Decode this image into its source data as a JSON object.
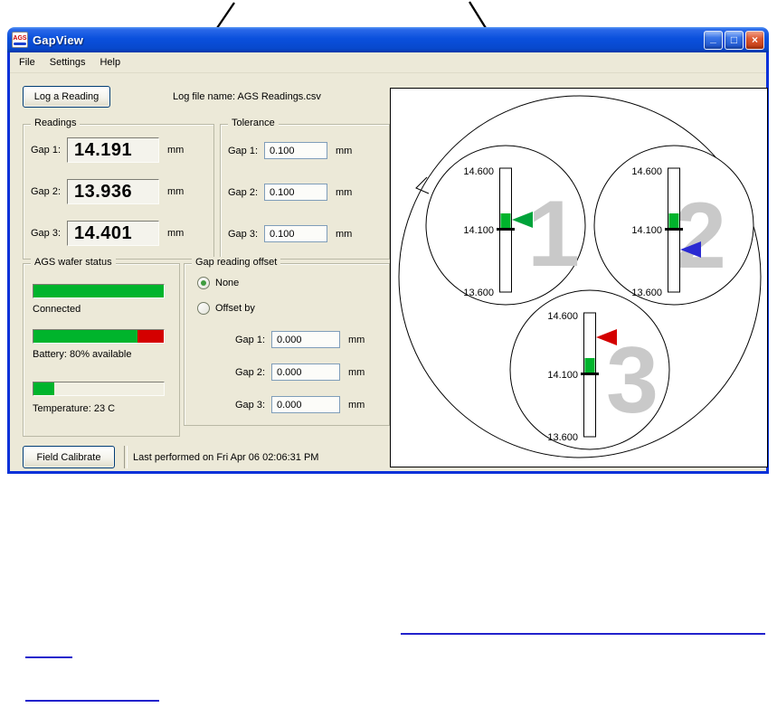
{
  "window": {
    "title": "GapView",
    "icon_text": "AGS",
    "controls": {
      "minimize": "_",
      "maximize": "□",
      "close": "×"
    }
  },
  "menubar": {
    "items": [
      "File",
      "Settings",
      "Help"
    ]
  },
  "toolbar": {
    "log_button": "Log a Reading",
    "log_file_label": "Log file name:  AGS Readings.csv"
  },
  "readings": {
    "title": "Readings",
    "rows": [
      {
        "label": "Gap 1:",
        "value": "14.191",
        "unit": "mm"
      },
      {
        "label": "Gap 2:",
        "value": "13.936",
        "unit": "mm"
      },
      {
        "label": "Gap 3:",
        "value": "14.401",
        "unit": "mm"
      }
    ]
  },
  "tolerance": {
    "title": "Tolerance",
    "rows": [
      {
        "label": "Gap 1:",
        "value": "0.100",
        "unit": "mm"
      },
      {
        "label": "Gap 2:",
        "value": "0.100",
        "unit": "mm"
      },
      {
        "label": "Gap 3:",
        "value": "0.100",
        "unit": "mm"
      }
    ]
  },
  "wafer_status": {
    "title": "AGS wafer status",
    "connected_label": "Connected",
    "connected_pct": 100,
    "battery_label": "Battery: 80% available",
    "battery_pct": 80,
    "temperature_label": "Temperature: 23 C",
    "temperature_pct": 16
  },
  "offset": {
    "title": "Gap reading offset",
    "options": [
      "None",
      "Offset by"
    ],
    "selected": "None",
    "rows": [
      {
        "label": "Gap 1:",
        "value": "0.000",
        "unit": "mm"
      },
      {
        "label": "Gap 2:",
        "value": "0.000",
        "unit": "mm"
      },
      {
        "label": "Gap 3:",
        "value": "0.000",
        "unit": "mm"
      }
    ]
  },
  "calibrate": {
    "button": "Field Calibrate",
    "status": "Last performed on Fri Apr 06 02:06:31 PM"
  },
  "gauges": {
    "scale": {
      "max": "14.600",
      "mid": "14.100",
      "min": "13.600"
    },
    "items": [
      {
        "number": "1",
        "color": "#00a33a",
        "reading": "14.191"
      },
      {
        "number": "2",
        "color": "#2a2ad2",
        "reading": "13.936"
      },
      {
        "number": "3",
        "color": "#d40000",
        "reading": "14.401"
      }
    ]
  },
  "colors": {
    "green": "#00b42c",
    "battery_red": "#d40000",
    "band_green": "#00b42c",
    "numeral_gray": "#c9c9c9",
    "link_blue": "#2222cc"
  }
}
